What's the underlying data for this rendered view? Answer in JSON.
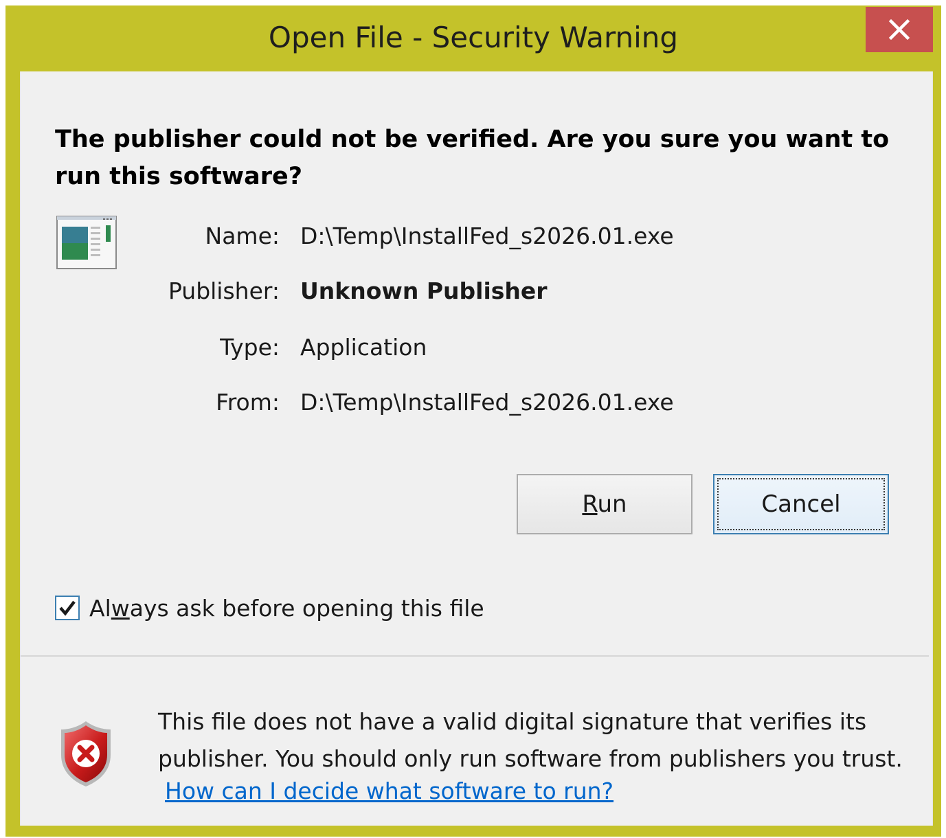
{
  "window": {
    "title": "Open File - Security Warning",
    "close_symbol": "✕",
    "frame_color": "#c4c22a",
    "close_color": "#c7504f"
  },
  "dialog": {
    "headline": "The publisher could not be verified.  Are you sure you want to run this software?",
    "properties": {
      "name_label": "Name:",
      "name_value": "D:\\Temp\\InstallFed_s2026.01.exe",
      "publisher_label": "Publisher:",
      "publisher_value": "Unknown Publisher",
      "type_label": "Type:",
      "type_value": "Application",
      "from_label": "From:",
      "from_value": "D:\\Temp\\InstallFed_s2026.01.exe"
    },
    "buttons": {
      "run_label_accel": "R",
      "run_label_rest": "un",
      "cancel_label": "Cancel"
    },
    "checkbox": {
      "checked": true,
      "label_before": "Al",
      "label_accel": "w",
      "label_after": "ays ask before opening this file"
    },
    "footer": {
      "warning_text": "This file does not have a valid digital signature that verifies its publisher.  You should only run software from publishers you trust.",
      "help_link": "How can I decide what software to run?"
    },
    "icons": {
      "file": "application-file-icon",
      "shield": "security-shield-error-icon",
      "check": "checkmark-icon"
    }
  }
}
